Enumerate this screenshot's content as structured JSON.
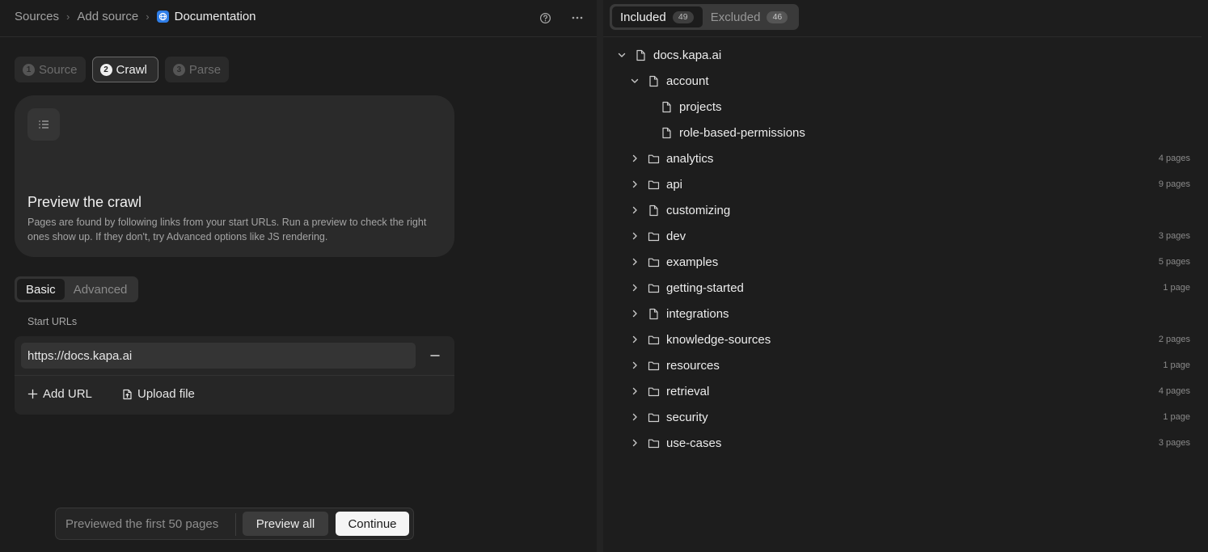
{
  "breadcrumb": {
    "items": [
      "Sources",
      "Add source"
    ],
    "current": "Documentation"
  },
  "steps": [
    {
      "num": "1",
      "label": "Source",
      "active": false
    },
    {
      "num": "2",
      "label": "Crawl",
      "active": true
    },
    {
      "num": "3",
      "label": "Parse",
      "active": false
    }
  ],
  "preview_card": {
    "title": "Preview the crawl",
    "description": "Pages are found by following links from your start URLs. Run a preview to check the right ones show up. If they don't, try Advanced options like JS rendering."
  },
  "mode_tabs": {
    "basic": "Basic",
    "advanced": "Advanced"
  },
  "start_urls": {
    "label": "Start URLs",
    "urls": [
      "https://docs.kapa.ai"
    ],
    "add_url": "Add URL",
    "upload_file": "Upload file"
  },
  "footer": {
    "status": "Previewed the first 50 pages",
    "preview_all": "Preview all",
    "continue": "Continue"
  },
  "results_tabs": {
    "included": {
      "label": "Included",
      "count": "49"
    },
    "excluded": {
      "label": "Excluded",
      "count": "46"
    }
  },
  "tree": {
    "root": "docs.kapa.ai",
    "account": {
      "label": "account",
      "children": [
        "projects",
        "role-based-permissions"
      ]
    },
    "items": [
      {
        "label": "analytics",
        "type": "folder",
        "count": "4 pages"
      },
      {
        "label": "api",
        "type": "folder",
        "count": "9 pages"
      },
      {
        "label": "customizing",
        "type": "file",
        "count": ""
      },
      {
        "label": "dev",
        "type": "folder",
        "count": "3 pages"
      },
      {
        "label": "examples",
        "type": "folder",
        "count": "5 pages"
      },
      {
        "label": "getting-started",
        "type": "folder",
        "count": "1 page"
      },
      {
        "label": "integrations",
        "type": "file",
        "count": ""
      },
      {
        "label": "knowledge-sources",
        "type": "folder",
        "count": "2 pages"
      },
      {
        "label": "resources",
        "type": "folder",
        "count": "1 page"
      },
      {
        "label": "retrieval",
        "type": "folder",
        "count": "4 pages"
      },
      {
        "label": "security",
        "type": "folder",
        "count": "1 page"
      },
      {
        "label": "use-cases",
        "type": "folder",
        "count": "3 pages"
      }
    ]
  }
}
